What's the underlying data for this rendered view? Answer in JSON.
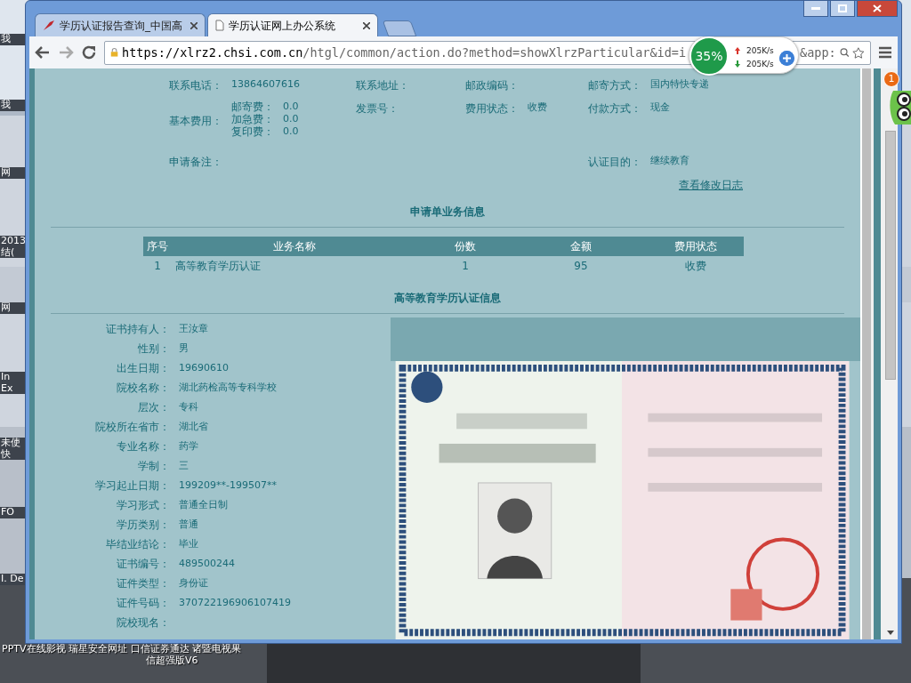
{
  "desktop": {
    "labels": [
      {
        "text": "我"
      },
      {
        "text": "我"
      },
      {
        "text": "网"
      },
      {
        "text": "2013结("
      },
      {
        "text": "网"
      },
      {
        "text": "In Ex"
      },
      {
        "text": "未使快"
      },
      {
        "text": "FO"
      },
      {
        "text": "I. De"
      }
    ],
    "taskbar_text": [
      "PPTV在线影视 瑞星安全网址 口信证券通达 诸暨电视果",
      "信超强版V6"
    ]
  },
  "browser": {
    "tabs": [
      {
        "title": "学历认证报告查询_中国高",
        "selected": false
      },
      {
        "title": "学历认证网上办公系统",
        "selected": true
      }
    ],
    "url_host": "https://xlrz2.chsi.com.cn",
    "url_path": "/htgl/common/action.do?method=showXlrzParticular&id=i",
    "url_tail": "&app:",
    "speed_widget": {
      "percent": "35%",
      "upload": "205K/s",
      "download": "205K/s"
    },
    "notification_count": "1"
  },
  "application_info": {
    "rows": [
      [
        {
          "label": "联系电话：",
          "value": "13864607616"
        },
        {
          "label": "联系地址："
        },
        {
          "label": "邮政编码："
        },
        {
          "label": "邮寄方式：",
          "value": "国内特快专递"
        }
      ],
      [
        {
          "label": "基本费用：",
          "fees": [
            {
              "label": "邮寄费：",
              "value": "0.0"
            },
            {
              "label": "加急费：",
              "value": "0.0"
            },
            {
              "label": "复印费：",
              "value": "0.0"
            }
          ]
        },
        {
          "label": "发票号："
        },
        {
          "label": "费用状态：",
          "value": "收费"
        },
        {
          "label": "付款方式：",
          "value": "现金"
        }
      ],
      [
        {
          "label": "申请备注："
        },
        {},
        {},
        {
          "label": "认证目的：",
          "value": "继续教育"
        }
      ]
    ],
    "log_link": "查看修改日志"
  },
  "business_section": {
    "title": "申请单业务信息",
    "table": {
      "columns": [
        "序号",
        "业务名称",
        "份数",
        "金额",
        "费用状态"
      ],
      "rows": [
        [
          "1",
          "高等教育学历认证",
          "1",
          "95",
          "收费"
        ]
      ]
    }
  },
  "certification_section": {
    "title": "高等教育学历认证信息",
    "fields": [
      {
        "label": "证书持有人：",
        "value": "王汝章"
      },
      {
        "label": "性别：",
        "value": "男"
      },
      {
        "label": "出生日期：",
        "value": "19690610"
      },
      {
        "label": "院校名称：",
        "value": "湖北药检高等专科学校"
      },
      {
        "label": "层次：",
        "value": "专科"
      },
      {
        "label": "院校所在省市：",
        "value": "湖北省"
      },
      {
        "label": "专业名称：",
        "value": "药学"
      },
      {
        "label": "学制：",
        "value": "三"
      },
      {
        "label": "学习起止日期：",
        "value": "199209**-199507**"
      },
      {
        "label": "学习形式：",
        "value": "普通全日制"
      },
      {
        "label": "学历类别：",
        "value": "普通"
      },
      {
        "label": "毕结业结论：",
        "value": "毕业"
      },
      {
        "label": "证书编号：",
        "value": "489500244"
      },
      {
        "label": "证件类型：",
        "value": "身份证"
      },
      {
        "label": "证件号码：",
        "value": "370722196906107419"
      },
      {
        "label": "院校现名："
      }
    ]
  }
}
